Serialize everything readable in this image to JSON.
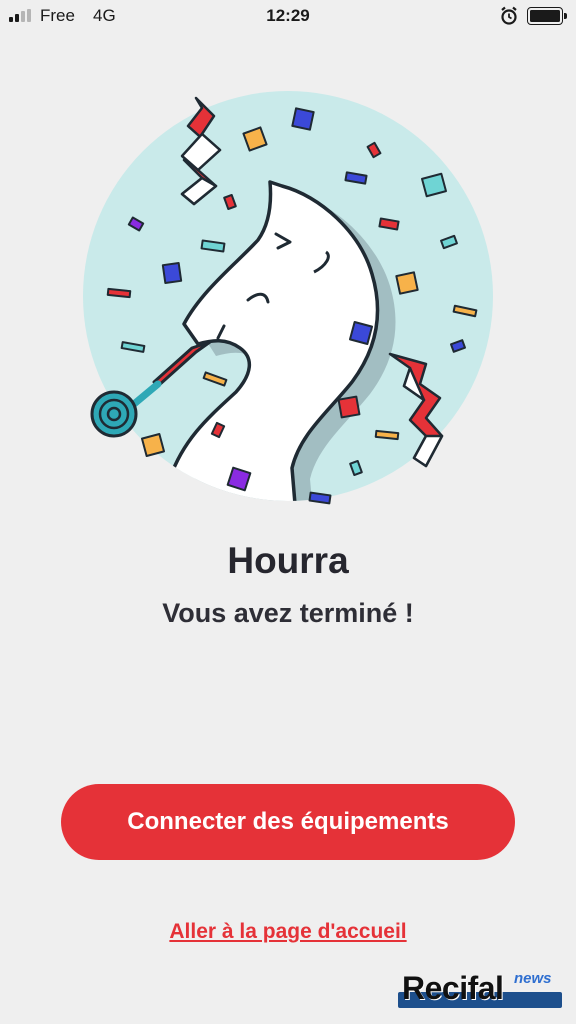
{
  "status_bar": {
    "carrier": "Free",
    "network": "4G",
    "time": "12:29",
    "icons": [
      "signal-icon",
      "alarm-icon",
      "battery-icon"
    ]
  },
  "illustration": {
    "icon": "horse-party-illustration",
    "colors": {
      "circle": "#c9eaea",
      "accent": "#e53238"
    }
  },
  "content": {
    "title": "Hourra",
    "subtitle": "Vous avez terminé !"
  },
  "actions": {
    "primary_label": "Connecter des équipements",
    "secondary_label": "Aller à la page d'accueil"
  },
  "watermark": {
    "main": "Recifal",
    "sub": "news"
  },
  "colors": {
    "background": "#efefef",
    "primary": "#e53238",
    "text": "#26262e"
  }
}
